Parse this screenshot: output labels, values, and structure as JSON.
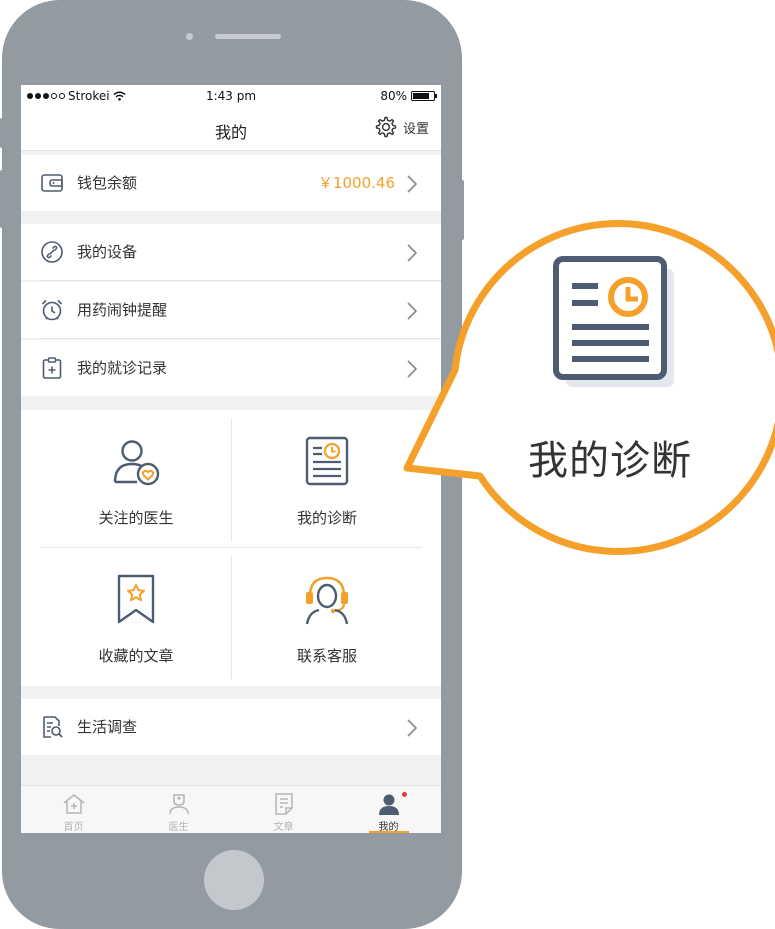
{
  "statusbar": {
    "carrier": "Strokei",
    "time": "1:43 pm",
    "battery": "80%"
  },
  "navbar": {
    "title": "我的",
    "settings_label": "设置",
    "settings_icon": "gear-icon"
  },
  "wallet": {
    "label": "钱包余额",
    "value": "￥1000.46",
    "icon": "wallet-icon"
  },
  "menu": [
    {
      "label": "我的设备",
      "icon": "link-icon"
    },
    {
      "label": "用药闹钟提醒",
      "icon": "alarm-clock-icon"
    },
    {
      "label": "我的就诊记录",
      "icon": "clipboard-plus-icon"
    }
  ],
  "grid": [
    {
      "label": "关注的医生",
      "icon": "doctor-heart-icon"
    },
    {
      "label": "我的诊断",
      "icon": "diagnosis-document-icon"
    },
    {
      "label": "收藏的文章",
      "icon": "bookmark-star-icon"
    },
    {
      "label": "联系客服",
      "icon": "customer-service-headset-icon"
    }
  ],
  "survey": {
    "label": "生活调查",
    "icon": "document-search-icon"
  },
  "tabs": [
    {
      "label": "首页",
      "icon": "home-icon",
      "active": false
    },
    {
      "label": "医生",
      "icon": "doctor-icon",
      "active": false
    },
    {
      "label": "文章",
      "icon": "article-icon",
      "active": false
    },
    {
      "label": "我的",
      "icon": "user-icon",
      "active": true
    }
  ],
  "callout": {
    "title": "我的诊断",
    "icon": "diagnosis-document-icon"
  },
  "colors": {
    "accent": "#f5a02a",
    "icon_dark": "#4e5c72",
    "phone": "#949aa1",
    "badge": "#e4393c"
  }
}
